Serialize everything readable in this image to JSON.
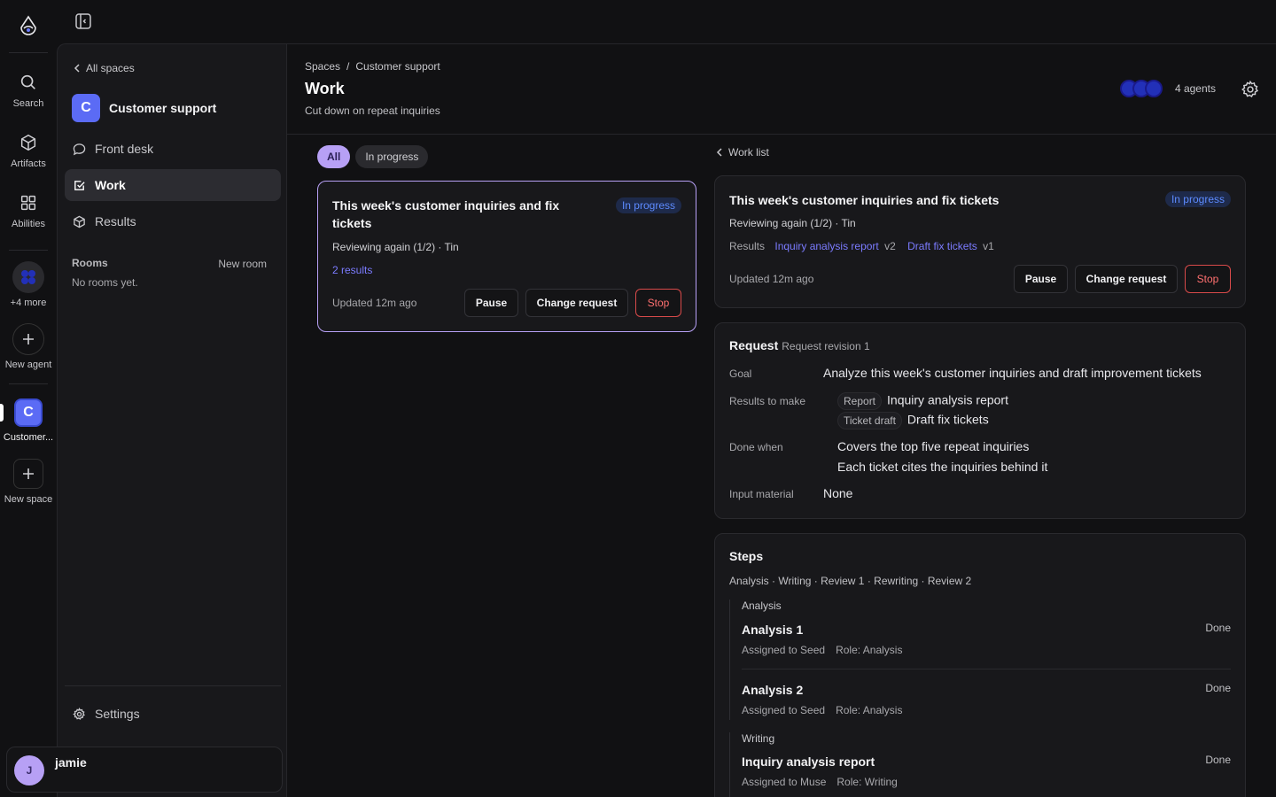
{
  "rail": {
    "items": [
      {
        "label": "Search"
      },
      {
        "label": "Artifacts"
      },
      {
        "label": "Abilities"
      }
    ],
    "more_label": "+4 more",
    "new_agent_label": "New agent",
    "space": {
      "letter": "C",
      "label": "Customer..."
    },
    "new_space_label": "New space"
  },
  "sidebar": {
    "back_label": "All spaces",
    "space_letter": "C",
    "space_name": "Customer support",
    "nav": [
      {
        "label": "Front desk",
        "icon": "chat-bubble-icon"
      },
      {
        "label": "Work",
        "icon": "checkbox-icon"
      },
      {
        "label": "Results",
        "icon": "cube-icon"
      }
    ],
    "rooms_heading": "Rooms",
    "new_room_label": "New room",
    "rooms_empty": "No rooms yet.",
    "settings_label": "Settings",
    "user": {
      "initial": "J",
      "name": "jamie"
    }
  },
  "header": {
    "breadcrumb": [
      "Spaces",
      "Customer support"
    ],
    "title": "Work",
    "subtitle": "Cut down on repeat inquiries",
    "agents_label": "4 agents"
  },
  "filters": [
    "All",
    "In progress"
  ],
  "work_card": {
    "title": "This week's customer inquiries and fix tickets",
    "status": "In progress",
    "progress": "Reviewing again (1/2) · Tin",
    "results_link": "2 results",
    "updated": "Updated 12m ago",
    "buttons": {
      "pause": "Pause",
      "change": "Change request",
      "stop": "Stop"
    }
  },
  "detail": {
    "back_label": "Work list",
    "title": "This week's customer inquiries and fix tickets",
    "status": "In progress",
    "progress": "Reviewing again (1/2) · Tin",
    "results_label": "Results",
    "results": [
      {
        "name": "Inquiry analysis report",
        "version": "v2"
      },
      {
        "name": "Draft fix tickets",
        "version": "v1"
      }
    ],
    "updated": "Updated 12m ago",
    "buttons": {
      "pause": "Pause",
      "change": "Change request",
      "stop": "Stop"
    }
  },
  "request": {
    "title": "Request",
    "revision": "Request revision 1",
    "goal_label": "Goal",
    "goal": "Analyze this week's customer inquiries and draft improvement tickets",
    "results_label": "Results to make",
    "results": [
      {
        "tag": "Report",
        "name": "Inquiry analysis report"
      },
      {
        "tag": "Ticket draft",
        "name": "Draft fix tickets"
      }
    ],
    "done_label": "Done when",
    "done": [
      "Covers the top five repeat inquiries",
      "Each ticket cites the inquiries behind it"
    ],
    "input_label": "Input material",
    "input": "None"
  },
  "steps": {
    "title": "Steps",
    "path": "Analysis · Writing · Review 1 · Rewriting · Review 2",
    "stages": [
      {
        "label": "Analysis",
        "items": [
          {
            "name": "Analysis 1",
            "assigned": "Assigned to Seed",
            "role": "Role: Analysis",
            "status": "Done"
          },
          {
            "name": "Analysis 2",
            "assigned": "Assigned to Seed",
            "role": "Role: Analysis",
            "status": "Done"
          }
        ]
      },
      {
        "label": "Writing",
        "items": [
          {
            "name": "Inquiry analysis report",
            "assigned": "Assigned to Muse",
            "role": "Role: Writing",
            "status": "Done"
          }
        ]
      }
    ]
  },
  "colors": {
    "accent": "#b7a0f5",
    "space": "#5b6bf5",
    "status_blue": "#5d8bff",
    "stop_red": "#ff7070"
  }
}
